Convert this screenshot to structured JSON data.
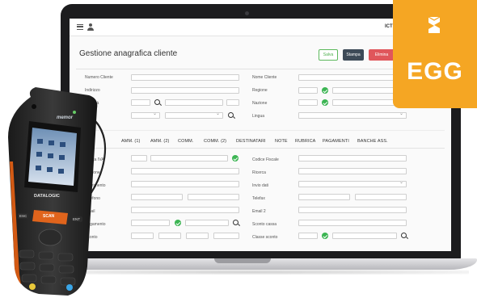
{
  "app": {
    "header_right": "ICT G",
    "page_title": "Gestione anagrafica cliente",
    "buttons": {
      "salva": "Salva",
      "stampa": "Stampa",
      "elimina": "Elimina"
    }
  },
  "form_top": {
    "numero_cliente": "Numero Cliente",
    "nome_cliente": "Nome Cliente",
    "indirizzo": "Indirizzo",
    "regione": "Regione",
    "localita": "Località",
    "nazione": "Nazione",
    "lingua": "Lingua"
  },
  "tabs": [
    "AMM. (1)",
    "AMM. (2)",
    "COMM.",
    "COMM. (2)",
    "DESTINATARI",
    "NOTE",
    "RUBRICA",
    "PAGAMENTI",
    "BANCHE ASS."
  ],
  "form_bottom": {
    "left": {
      "partita_iva": "Partita IVA",
      "ragione": "Ragione",
      "riferimento": "Riferimento",
      "telefono": "Telefono",
      "email": "Email",
      "pagamento": "Pagamento",
      "sconto": "Sconto"
    },
    "right": {
      "codice_fiscale": "Codice Fiscale",
      "ricerca": "Ricerca",
      "invio_dati": "Invio dati",
      "telefax": "Telefax",
      "email_2": "Email 2",
      "sconto_cassa": "Sconto cassa",
      "classe_sconto": "Classe sconto"
    }
  },
  "badge": {
    "text": "EGG",
    "color": "#f5a623"
  },
  "scanner": {
    "brand": "DATALOGIC",
    "screen_brand": "memor",
    "scan_label": "SCAN",
    "esc_label": "ESC",
    "ent_label": "ENT"
  }
}
